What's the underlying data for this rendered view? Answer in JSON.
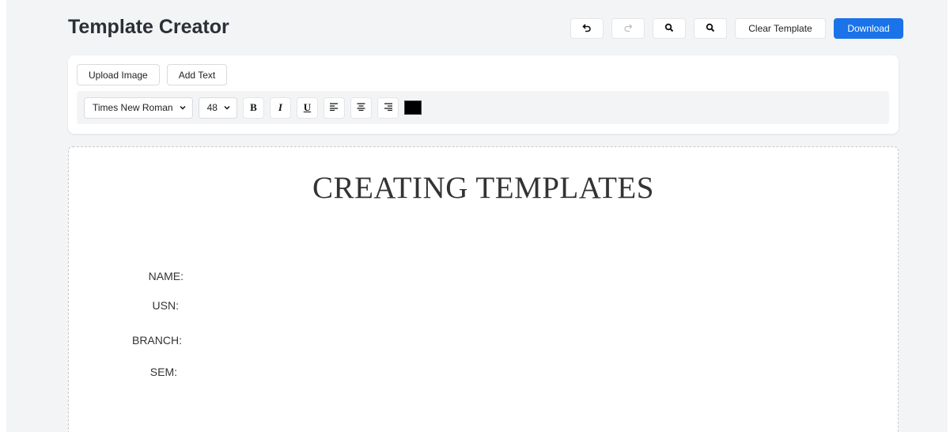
{
  "header": {
    "title": "Template Creator"
  },
  "topbar": {
    "undo_icon": "undo-icon",
    "redo_icon": "redo-icon",
    "zoom_in_icon": "zoom-in-icon",
    "zoom_out_icon": "zoom-out-icon",
    "clear_label": "Clear Template",
    "download_label": "Download"
  },
  "toolbar": {
    "upload_label": "Upload Image",
    "add_text_label": "Add Text",
    "font_family": "Times New Roman",
    "font_size": "48",
    "bold_label": "B",
    "italic_label": "I",
    "underline_label": "U",
    "text_color": "#000000"
  },
  "canvas": {
    "title": "CREATING TEMPLATES",
    "fields": [
      "NAME:",
      "USN:",
      "BRANCH:",
      "SEM:"
    ]
  },
  "colors": {
    "accent": "#1a73e8",
    "background": "#f3f4f6"
  }
}
